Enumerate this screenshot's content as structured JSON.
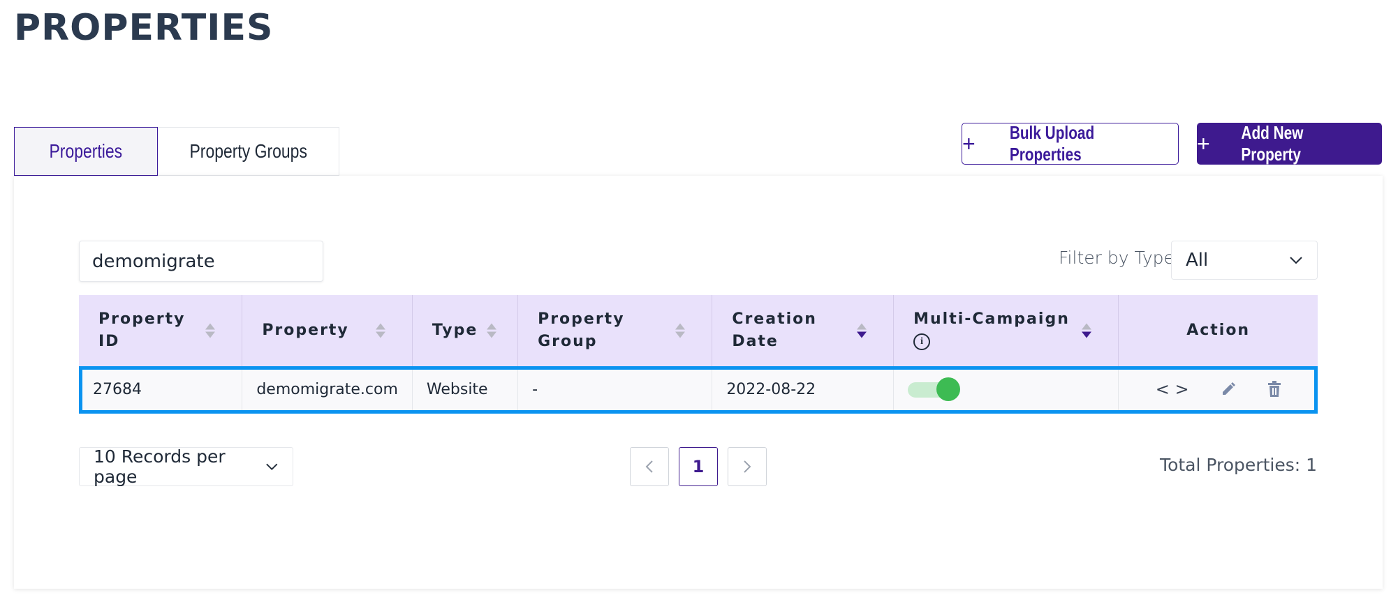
{
  "page": {
    "title": "PROPERTIES"
  },
  "tabs": [
    {
      "label": "Properties",
      "active": true
    },
    {
      "label": "Property Groups",
      "active": false
    }
  ],
  "toolbar": {
    "bulk_upload_label": "Bulk Upload Properties",
    "add_new_label": "Add New Property"
  },
  "search": {
    "value": "demomigrate",
    "placeholder": ""
  },
  "filter": {
    "label": "Filter by Type:",
    "selected": "All"
  },
  "table": {
    "headers": {
      "property_id_1": "Property",
      "property_id_2": "ID",
      "property": "Property",
      "type": "Type",
      "property_group_1": "Property",
      "property_group_2": "Group",
      "creation_date_1": "Creation",
      "creation_date_2": "Date",
      "multi_campaign": "Multi-Campaign",
      "action": "Action"
    },
    "rows": [
      {
        "property_id": "27684",
        "property": "demomigrate.com",
        "type": "Website",
        "property_group": "-",
        "creation_date": "2022-08-22",
        "multi_campaign": true
      }
    ]
  },
  "pagination": {
    "per_page_label": "10 Records per page",
    "current_page": "1",
    "total_label": "Total Properties: 1"
  },
  "colors": {
    "brand": "#3e1a8e",
    "header_bg": "#e9e1fb",
    "highlight": "#0a93f0",
    "toggle_on": "#3dbb53"
  },
  "icons": [
    "plus-icon",
    "chevron-down-icon",
    "info-icon",
    "code-icon",
    "edit-icon",
    "trash-icon",
    "chevron-left-icon",
    "chevron-right-icon",
    "sort-icon"
  ]
}
